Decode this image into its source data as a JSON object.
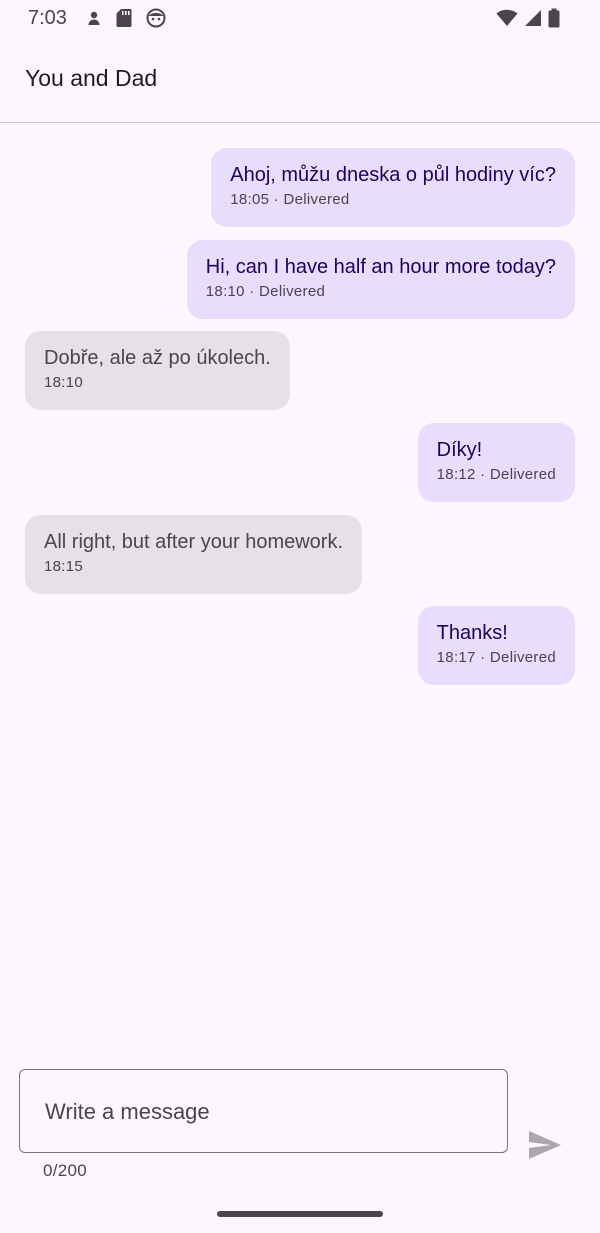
{
  "status_bar": {
    "time": "7:03",
    "left_icons": [
      "person-icon",
      "sd-card-icon",
      "face-icon"
    ],
    "right_icons": [
      "wifi-icon",
      "signal-icon",
      "battery-icon"
    ]
  },
  "app_bar": {
    "title": "You and Dad"
  },
  "messages": [
    {
      "direction": "sent",
      "text": "Ahoj, můžu dneska o půl hodiny víc?",
      "meta": "18:05 · Delivered"
    },
    {
      "direction": "sent",
      "text": "Hi, can I have half an hour more today?",
      "meta": "18:10 · Delivered"
    },
    {
      "direction": "received",
      "text": "Dobře, ale až po úkolech.",
      "meta": "18:10"
    },
    {
      "direction": "sent",
      "text": "Díky!",
      "meta": "18:12 · Delivered"
    },
    {
      "direction": "received",
      "text": "All right, but after your homework.",
      "meta": "18:15"
    },
    {
      "direction": "sent",
      "text": "Thanks!",
      "meta": "18:17 · Delivered"
    }
  ],
  "composer": {
    "placeholder": "Write a message",
    "value": "",
    "counter": "0/200",
    "send_icon": "send-icon"
  },
  "colors": {
    "background": "#fdf7fd",
    "sent_bubble": "#e7ddfd",
    "received_bubble": "#e7e0e8",
    "sent_text": "#21005d",
    "received_text": "#49454f"
  }
}
